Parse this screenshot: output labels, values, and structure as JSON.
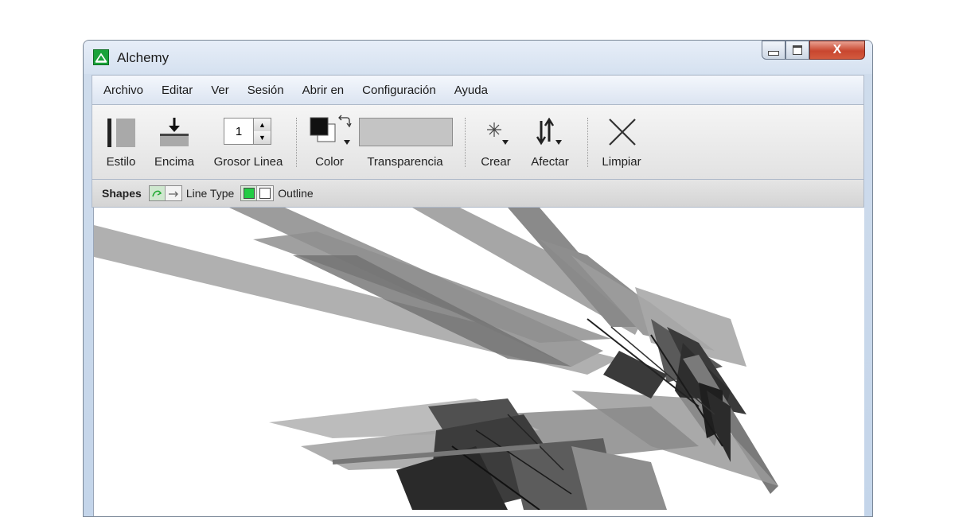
{
  "window": {
    "title": "Alchemy",
    "close_glyph": "X"
  },
  "menu": [
    "Archivo",
    "Editar",
    "Ver",
    "Sesión",
    "Abrir en",
    "Configuración",
    "Ayuda"
  ],
  "toolbar": {
    "style_label": "Estilo",
    "encima_label": "Encima",
    "grosor_label": "Grosor Linea",
    "grosor_value": "1",
    "color_label": "Color",
    "transparencia_label": "Transparencia",
    "crear_label": "Crear",
    "afectar_label": "Afectar",
    "limpiar_label": "Limpiar"
  },
  "shapes": {
    "title": "Shapes",
    "line_type_label": "Line Type",
    "outline_label": "Outline"
  },
  "colors": {
    "app_icon": "#1aa33a",
    "outline_toggle": "#22cc44",
    "stroke_dark": "#222222",
    "stroke_mid": "#7a7a7a",
    "stroke_light": "#b8b8b8"
  },
  "icons": [
    "app-icon",
    "minimize-icon",
    "maximize-icon",
    "close-icon",
    "style-icon",
    "encima-icon",
    "stepper-up-icon",
    "stepper-down-icon",
    "color-swatch-icon",
    "swap-colors-icon",
    "crear-icon",
    "afectar-icon",
    "limpiar-icon",
    "line-type-icon",
    "outline-icon"
  ]
}
